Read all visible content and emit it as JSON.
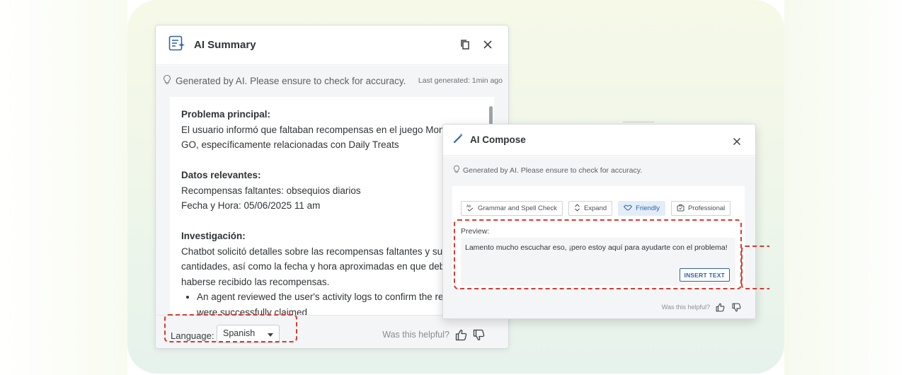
{
  "summary": {
    "title": "AI Summary",
    "disclaimer": "Generated by AI. Please ensure to check for accuracy.",
    "last_generated": "Last generated: 1min ago",
    "sections": [
      {
        "heading": "Problema principal:",
        "lines": [
          "El usuario informó que faltaban recompensas en el juego Mon",
          "GO, específicamente relacionadas con Daily Treats"
        ]
      },
      {
        "heading": "Datos relevantes:",
        "lines": [
          "Recompensas faltantes: obsequios diarios",
          "Fecha y Hora: 05/06/2025 11 am"
        ]
      },
      {
        "heading": "Investigación:",
        "lines": [
          "Chatbot solicitó detalles sobre las recompensas faltantes y sus",
          "cantidades, así como la fecha y hora aproximadas en que debe",
          "haberse recibido las recompensas."
        ]
      }
    ],
    "bullet_lines": [
      "An agent reviewed the user's activity logs to confirm the re",
      "were successfully claimed"
    ],
    "language_label": "Language:",
    "language_value": "Spanish",
    "helpful_text": "Was this helpful?"
  },
  "compose": {
    "title": "AI Compose",
    "disclaimer": "Generated by AI. Please ensure to check for accuracy.",
    "chips": [
      {
        "label": "Grammar and Spell Check",
        "icon": "spellcheck-icon"
      },
      {
        "label": "Expand",
        "icon": "expand-icon"
      },
      {
        "label": "Friendly",
        "icon": "handshake-icon"
      },
      {
        "label": "Professional",
        "icon": "briefcase-icon"
      }
    ],
    "preview_label": "Preview:",
    "preview_text": "Lamento mucho escuchar eso, ¡pero estoy aquí para ayudarte con el problema!",
    "insert_label": "INSERT TEXT",
    "helpful_text": "Was this helpful?"
  },
  "colors": {
    "accent": "#2e63a8",
    "annotation": "#d83a2f",
    "text": "#2f3437"
  }
}
